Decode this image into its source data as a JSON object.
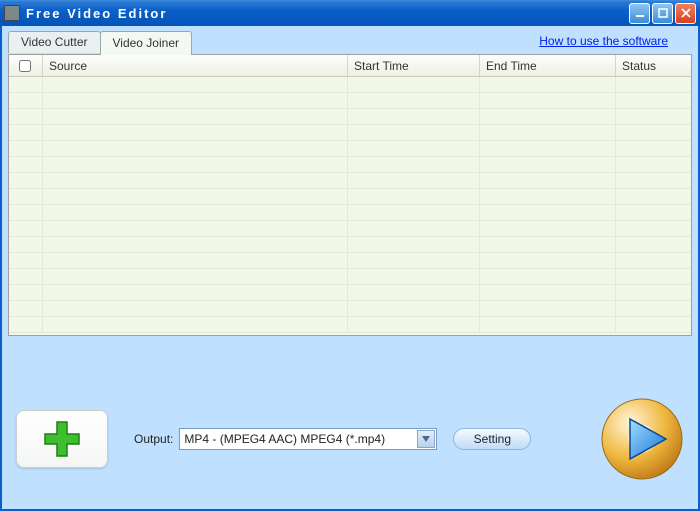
{
  "window": {
    "title": "Free Video Editor"
  },
  "tabs": [
    {
      "label": "Video Cutter",
      "active": false
    },
    {
      "label": "Video Joiner",
      "active": true
    }
  ],
  "help_link": "How to use the software",
  "table": {
    "columns": {
      "source": "Source",
      "start_time": "Start Time",
      "end_time": "End Time",
      "status": "Status"
    },
    "rows": []
  },
  "output": {
    "label": "Output:",
    "selected": "MP4 - (MPEG4 AAC) MPEG4 (*.mp4)"
  },
  "buttons": {
    "setting": "Setting"
  },
  "icons": {
    "add": "plus-icon",
    "play": "play-disc-icon"
  }
}
